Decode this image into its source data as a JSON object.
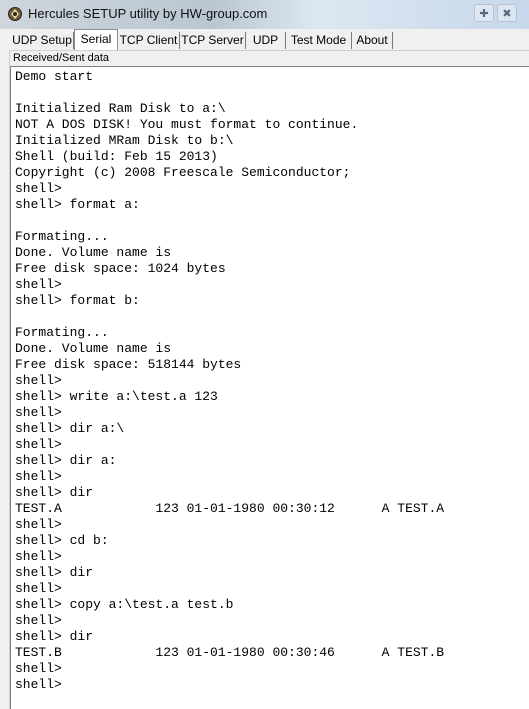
{
  "window": {
    "title": "Hercules SETUP utility by HW-group.com",
    "control_icons": [
      "✚",
      "✖"
    ]
  },
  "tabs": [
    {
      "label": "UDP Setup",
      "active": false
    },
    {
      "label": "Serial",
      "active": true
    },
    {
      "label": "TCP Client",
      "active": false
    },
    {
      "label": "TCP Server",
      "active": false
    },
    {
      "label": "UDP",
      "active": false
    },
    {
      "label": "Test Mode",
      "active": false
    },
    {
      "label": "About",
      "active": false
    }
  ],
  "panel": {
    "label": "Received/Sent data"
  },
  "terminal_lines": [
    "Demo start",
    "",
    "Initialized Ram Disk to a:\\",
    "NOT A DOS DISK! You must format to continue.",
    "Initialized MRam Disk to b:\\",
    "Shell (build: Feb 15 2013)",
    "Copyright (c) 2008 Freescale Semiconductor;",
    "shell>",
    "shell> format a:",
    "",
    "Formating...",
    "Done. Volume name is",
    "Free disk space: 1024 bytes",
    "shell>",
    "shell> format b:",
    "",
    "Formating...",
    "Done. Volume name is",
    "Free disk space: 518144 bytes",
    "shell>",
    "shell> write a:\\test.a 123",
    "shell>",
    "shell> dir a:\\",
    "shell>",
    "shell> dir a:",
    "shell>",
    "shell> dir",
    "TEST.A            123 01-01-1980 00:30:12      A TEST.A",
    "shell>",
    "shell> cd b:",
    "shell>",
    "shell> dir",
    "shell>",
    "shell> copy a:\\test.a test.b",
    "shell>",
    "shell> dir",
    "TEST.B            123 01-01-1980 00:30:46      A TEST.B",
    "shell>",
    "shell>"
  ]
}
